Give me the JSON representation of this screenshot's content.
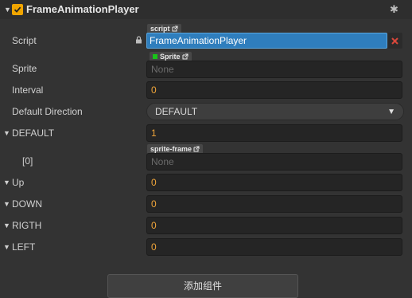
{
  "component": {
    "title": "FrameAnimationPlayer",
    "enabled": true
  },
  "script": {
    "label": "Script",
    "tag": "script",
    "value": "FrameAnimationPlayer"
  },
  "sprite": {
    "label": "Sprite",
    "tag": "Sprite",
    "value": "None"
  },
  "interval": {
    "label": "Interval",
    "value": "0"
  },
  "default_direction": {
    "label": "Default Direction",
    "value": "DEFAULT"
  },
  "default_group": {
    "label": "DEFAULT",
    "count": "1",
    "item": {
      "label": "[0]",
      "tag": "sprite-frame",
      "value": "None"
    }
  },
  "up": {
    "label": "Up",
    "count": "0"
  },
  "down": {
    "label": "DOWN",
    "count": "0"
  },
  "rigth": {
    "label": "RIGTH",
    "count": "0"
  },
  "left": {
    "label": "LEFT",
    "count": "0"
  },
  "add_component_label": "添加组件",
  "colors": {
    "accent_orange": "#f0a500",
    "number_orange": "#f0a53a",
    "selected_blue": "#2f7ebd",
    "clear_red": "#c0392b",
    "sprite_green": "#18c418"
  }
}
